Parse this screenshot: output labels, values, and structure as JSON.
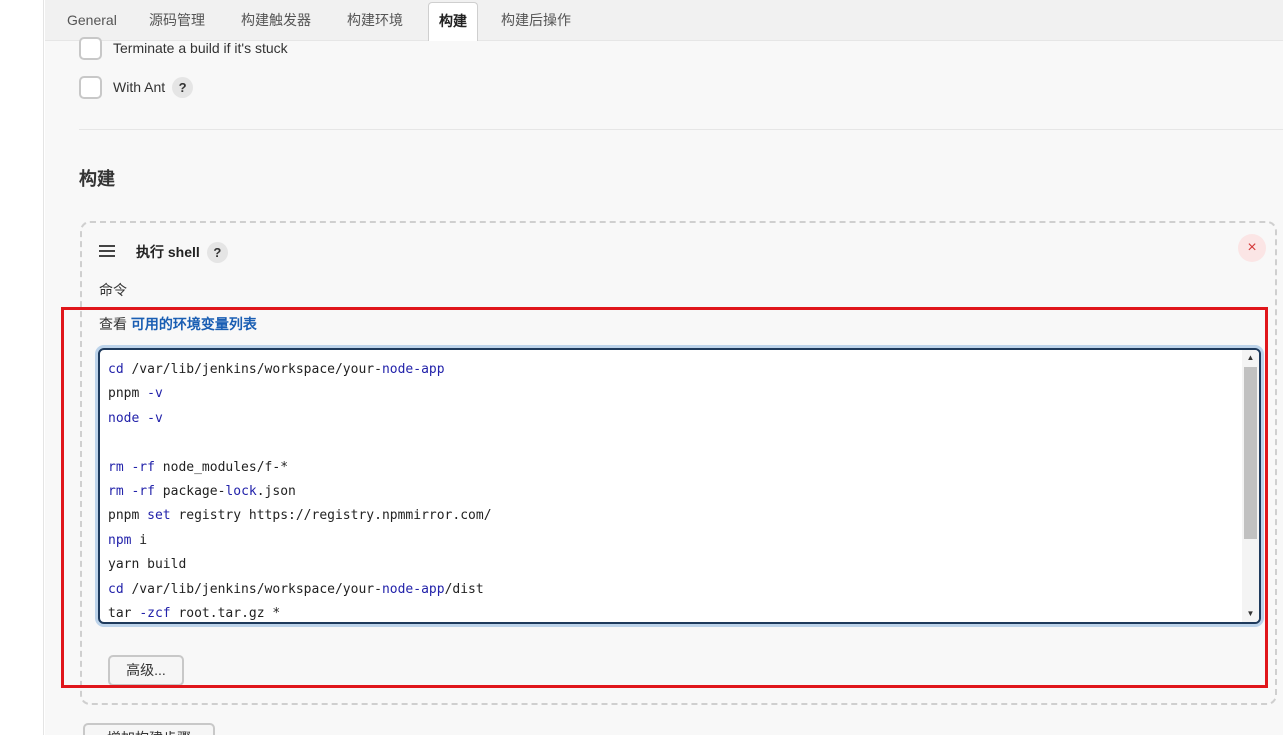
{
  "tabs": [
    {
      "label": "General"
    },
    {
      "label": "源码管理"
    },
    {
      "label": "构建触发器"
    },
    {
      "label": "构建环境"
    },
    {
      "label": "构建",
      "active": true
    },
    {
      "label": "构建后操作"
    }
  ],
  "build_env": {
    "options": [
      {
        "label": "Terminate a build if it's stuck",
        "checked": false
      },
      {
        "label": "With Ant",
        "checked": false,
        "help": "?"
      }
    ]
  },
  "build_section": {
    "title": "构建",
    "step": {
      "title": "执行 shell",
      "help": "?",
      "close": "×",
      "command_label": "命令",
      "env_prefix": "查看",
      "env_link": "可用的环境变量列表",
      "command_lines": [
        "cd /var/lib/jenkins/workspace/your-node-app",
        "pnpm -v",
        "node -v",
        "",
        "rm -rf node_modules/f-*",
        "rm -rf package-lock.json",
        "pnpm set registry https://registry.npmmirror.com/",
        "npm i",
        "yarn build",
        "cd /var/lib/jenkins/workspace/your-node-app/dist",
        "tar -zcf root.tar.gz *"
      ],
      "advanced_label": "高级..."
    },
    "add_step_label": "增加构建步骤"
  },
  "colors": {
    "link": "#1a5eb3",
    "highlight": "#e0161b",
    "keyword": "#2222aa",
    "editor_border": "#1e3a5c"
  }
}
